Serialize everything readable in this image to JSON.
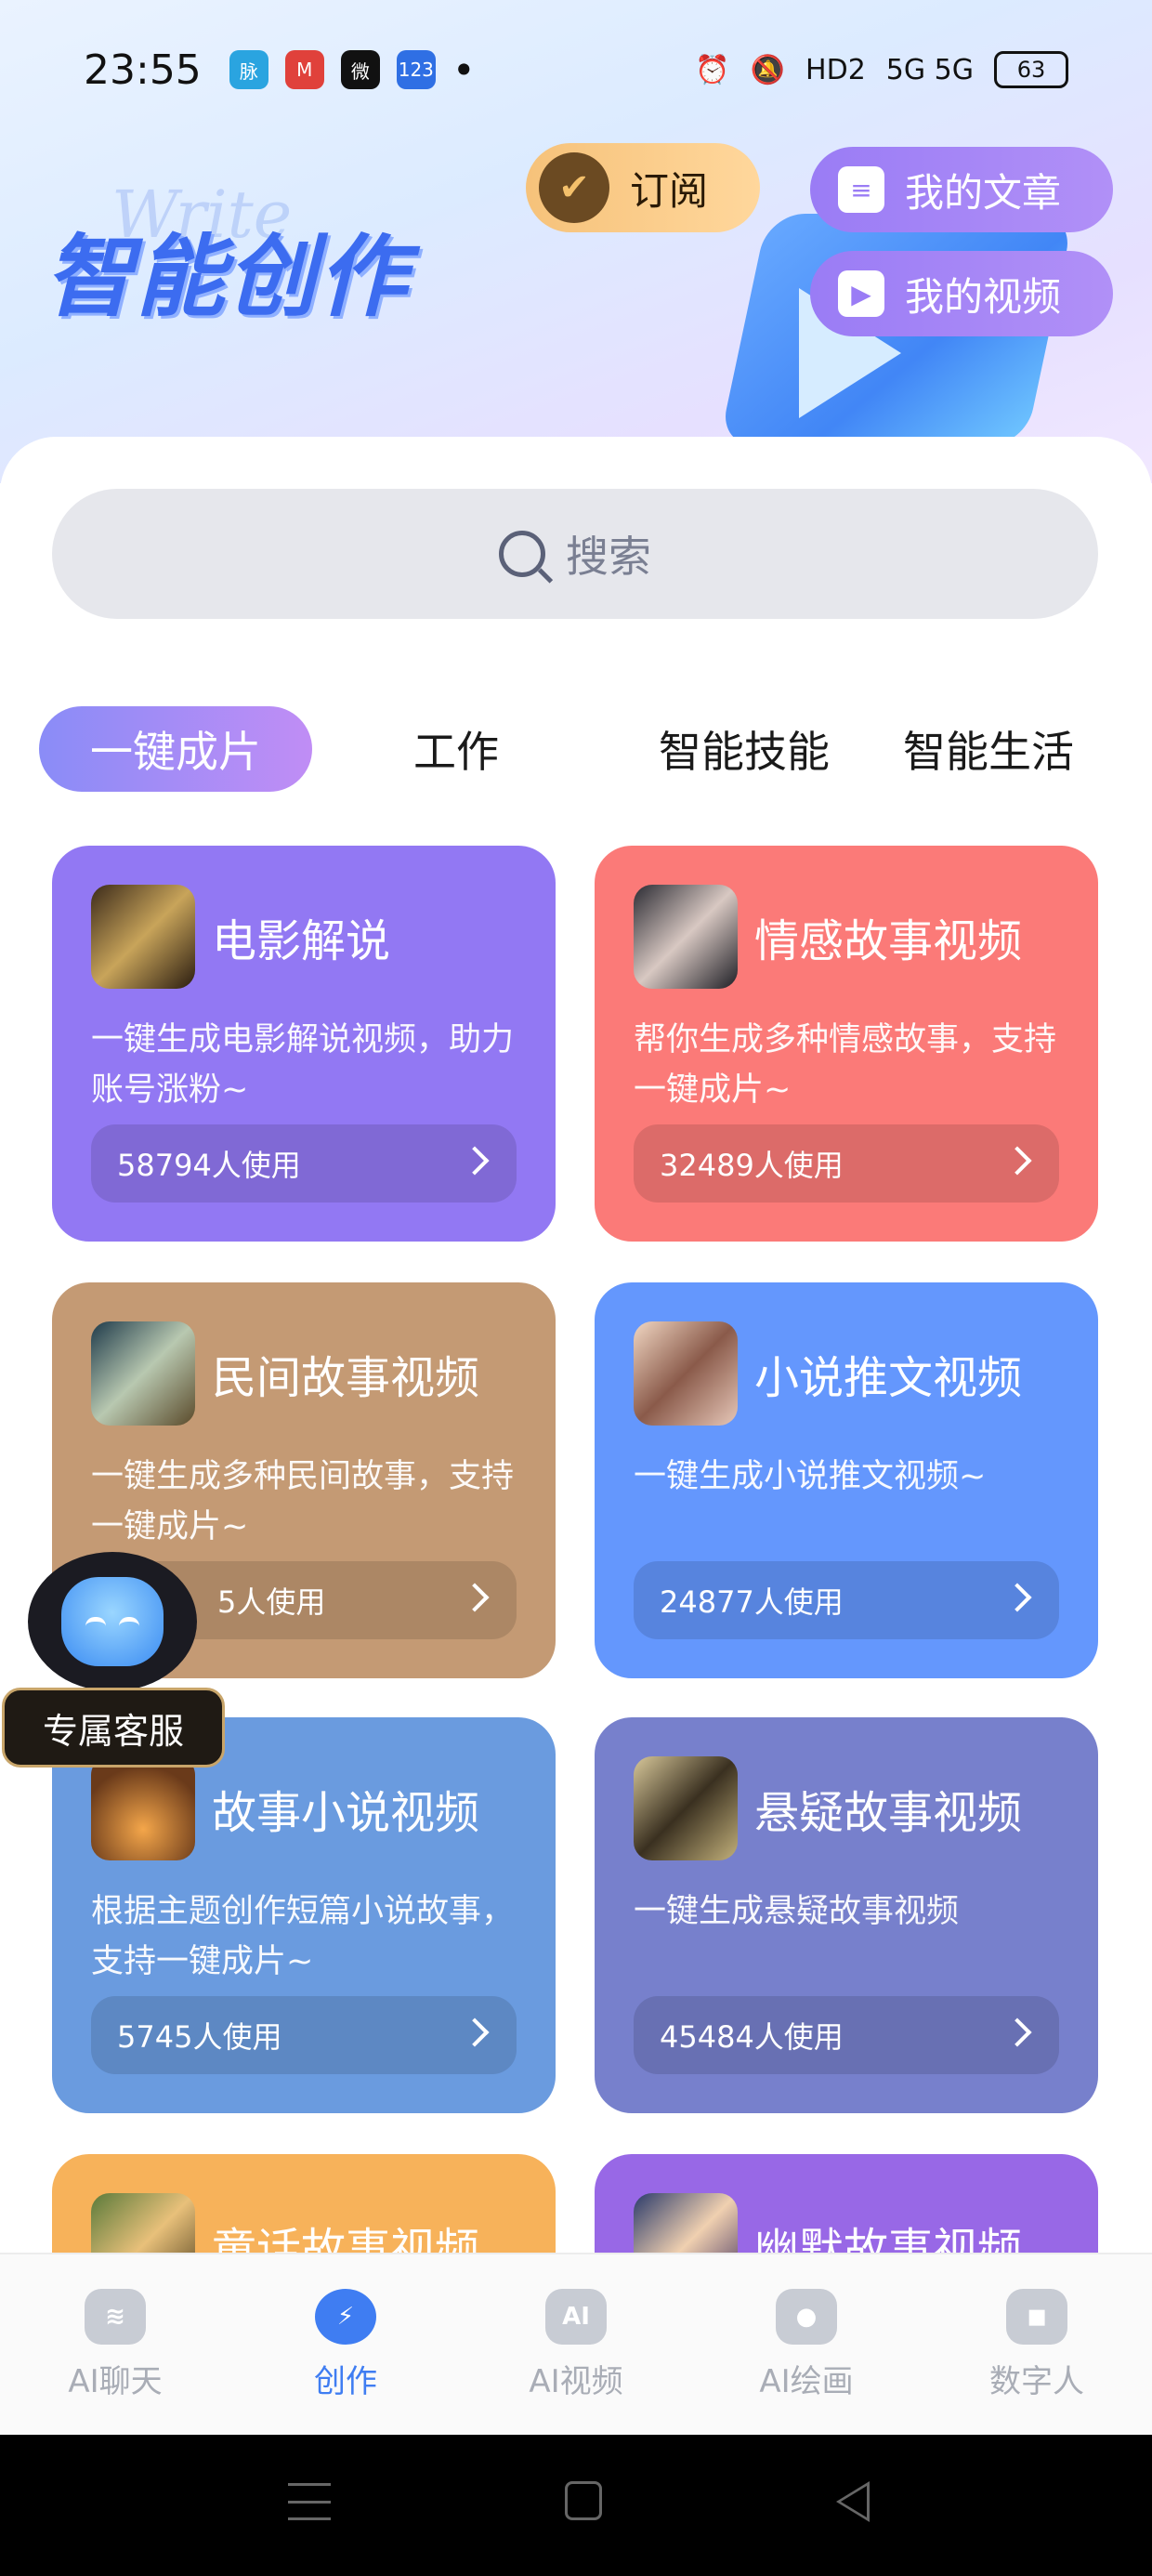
{
  "status_bar": {
    "time": "23:55",
    "apps": [
      "脉",
      "M",
      "微",
      "123"
    ],
    "network": "5G 5G",
    "hd": "HD2",
    "battery": "63"
  },
  "header": {
    "title": "智能创作",
    "title_ghost": "Write",
    "subscribe_label": "订阅",
    "my_articles_label": "我的文章",
    "my_videos_label": "我的视频"
  },
  "search": {
    "placeholder": "搜索"
  },
  "tabs": [
    {
      "label": "一键成片",
      "active": true
    },
    {
      "label": "工作",
      "active": false
    },
    {
      "label": "智能技能",
      "active": false
    },
    {
      "label": "智能生活",
      "active": false
    }
  ],
  "cards": [
    {
      "title": "电影解说",
      "desc": "一键生成电影解说视频，助力账号涨粉~",
      "usage": "58794人使用",
      "color": "#9278f3"
    },
    {
      "title": "情感故事视频",
      "desc": "帮你生成多种情感故事，支持一键成片~",
      "usage": "32489人使用",
      "color": "#fb7a78"
    },
    {
      "title": "民间故事视频",
      "desc": "一键生成多种民间故事，支持一键成片~",
      "usage": "5人使用",
      "color": "#c49a74"
    },
    {
      "title": "小说推文视频",
      "desc": "一键生成小说推文视频~",
      "usage": "24877人使用",
      "color": "#6497fd"
    },
    {
      "title": "故事小说视频",
      "desc": "根据主题创作短篇小说故事，支持一键成片~",
      "usage": "5745人使用",
      "color": "#6a9bdf"
    },
    {
      "title": "悬疑故事视频",
      "desc": "一键生成悬疑故事视频",
      "usage": "45484人使用",
      "color": "#7780cc"
    },
    {
      "title": "童话故事视频",
      "desc": "",
      "usage": "",
      "color": "#f7b25a"
    },
    {
      "title": "幽默故事视频",
      "desc": "",
      "usage": "",
      "color": "#9868e6"
    }
  ],
  "service": {
    "label": "专属客服"
  },
  "bottom_nav": [
    {
      "label": "AI聊天",
      "icon": "chat-icon",
      "glyph": "≋",
      "active": false
    },
    {
      "label": "创作",
      "icon": "lightning-icon",
      "glyph": "⚡",
      "active": true
    },
    {
      "label": "AI视频",
      "icon": "video-camera-icon",
      "glyph": "AI",
      "active": false
    },
    {
      "label": "AI绘画",
      "icon": "palette-icon",
      "glyph": "●",
      "active": false
    },
    {
      "label": "数字人",
      "icon": "robot-icon",
      "glyph": "◼",
      "active": false
    }
  ],
  "colors": {
    "accent": "#3f7df2",
    "title": "#3c6cf0"
  }
}
